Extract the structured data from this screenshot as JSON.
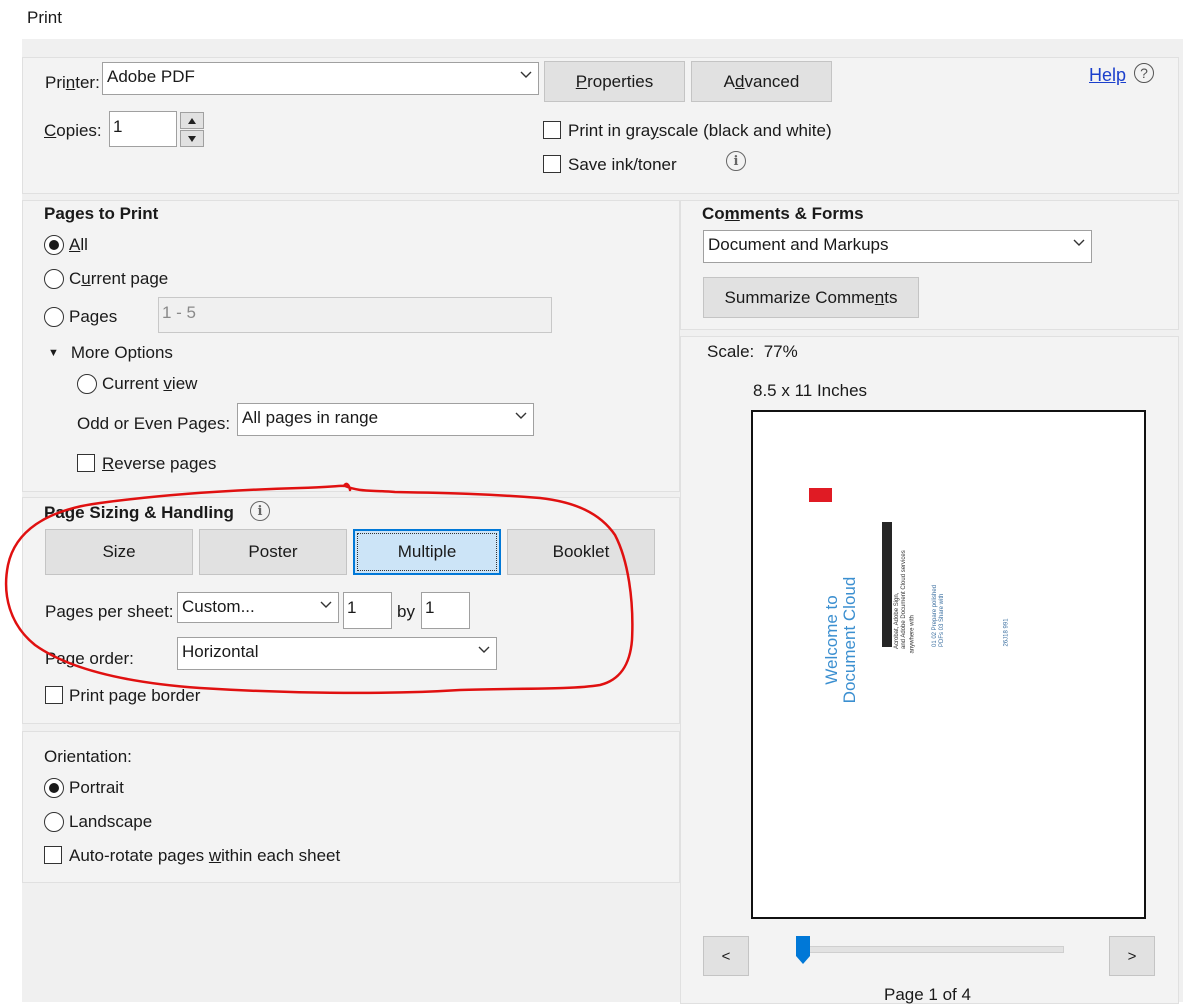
{
  "window": {
    "title": "Print"
  },
  "help": {
    "label": "Help",
    "icon": "question-icon"
  },
  "printer": {
    "label_pre": "Pri",
    "label_u": "n",
    "label_post": "ter:",
    "value": "Adobe PDF",
    "properties_pre": "",
    "properties_u": "P",
    "properties_post": "roperties",
    "advanced_pre": "A",
    "advanced_u": "d",
    "advanced_post": "vanced"
  },
  "copies": {
    "label_u": "C",
    "label_post": "opies:",
    "value": "1"
  },
  "grayscale": {
    "label_pre": "Print in gra",
    "label_u": "y",
    "label_post": "scale (black and white)",
    "checked": false
  },
  "save_ink": {
    "label": "Save ink/toner",
    "checked": false
  },
  "pages_to_print": {
    "heading": "Pages to Print",
    "all_u": "A",
    "all_post": "ll",
    "current_pre": "C",
    "current_u": "u",
    "current_post": "rrent page",
    "pages_label": "Pages",
    "pages_value": "1 - 5",
    "more_options": "More Options",
    "current_view_pre": "Current ",
    "current_view_u": "v",
    "current_view_post": "iew",
    "odd_even_label": "Odd or Even Pages:",
    "odd_even_value": "All pages in range",
    "reverse_u": "R",
    "reverse_post": "everse pages"
  },
  "comments_forms": {
    "heading_pre": "Co",
    "heading_u": "m",
    "heading_post": "ments & Forms",
    "value": "Document and Markups",
    "summarize_pre": "Summarize Comme",
    "summarize_u": "n",
    "summarize_post": "ts"
  },
  "page_sizing": {
    "heading": "Page Sizing & Handling",
    "tabs": [
      "Size",
      "Poster",
      "Multiple",
      "Booklet"
    ],
    "selected_tab": "Multiple",
    "pages_per_sheet_label": "Pages per sheet:",
    "pages_per_sheet_value": "Custom...",
    "cols": "1",
    "by": "by",
    "rows": "1",
    "page_order_label": "Page order:",
    "page_order_value": "Horizontal",
    "print_border": "Print page border"
  },
  "orientation": {
    "heading": "Orientation:",
    "portrait": "Portrait",
    "landscape": "Landscape",
    "autorotate_pre": "Auto-rotate pages ",
    "autorotate_u": "w",
    "autorotate_post": "ithin each sheet"
  },
  "preview": {
    "scale_label": "Scale:",
    "scale_value": "77%",
    "paper_size": "8.5 x 11 Inches",
    "doc_title_line1": "Welcome to",
    "doc_title_line2": "Document Cloud",
    "doc_text1": "Acrobat, Adobe Sign,",
    "doc_text2": "and Adobe Document Cloud services",
    "doc_text3": "anywhere with",
    "doc_text4": "01  02  Prepare polished",
    "doc_text5": "PDFs  03  Share with",
    "doc_text6": "26J18 991",
    "prev": "<",
    "next": ">",
    "page_status": "Page 1 of 4"
  },
  "colors": {
    "accent": "#0078d7",
    "annotation": "#e01010",
    "link": "#1a3fcc",
    "adobe_red": "#e01b24",
    "doc_blue": "#3b8fd0"
  }
}
